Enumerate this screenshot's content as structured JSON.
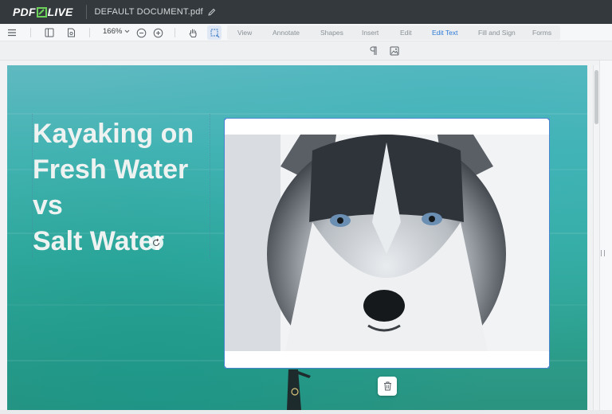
{
  "header": {
    "logo_left": "PDF",
    "logo_right": "LIVE",
    "document_title": "DEFAULT DOCUMENT.pdf"
  },
  "toolbar": {
    "zoom": "166%",
    "tabs": [
      {
        "label": "View"
      },
      {
        "label": "Annotate"
      },
      {
        "label": "Shapes"
      },
      {
        "label": "Insert"
      },
      {
        "label": "Edit"
      },
      {
        "label": "Edit Text",
        "selected": true
      },
      {
        "label": "Fill and Sign"
      },
      {
        "label": "Forms"
      }
    ]
  },
  "page": {
    "title_lines": [
      "Kayaking on",
      "Fresh Water",
      "vs",
      "Salt Water"
    ]
  },
  "colors": {
    "topbar": "#33393c",
    "accent": "#2d7ad6",
    "selection": "#3b7fd4",
    "water": "#33ab9f"
  },
  "icons": {
    "menu": "hamburger-icon",
    "sidebar": "sidebar-panel-icon",
    "thumbnail": "page-settings-icon",
    "zoom_out": "zoom-out-icon",
    "zoom_in": "zoom-in-icon",
    "hand": "hand-pan-icon",
    "select": "area-select-icon",
    "paragraph": "paragraph-icon",
    "image": "image-icon",
    "delete": "trash-icon",
    "rotate": "rotate-icon",
    "pencil": "pencil-icon"
  }
}
